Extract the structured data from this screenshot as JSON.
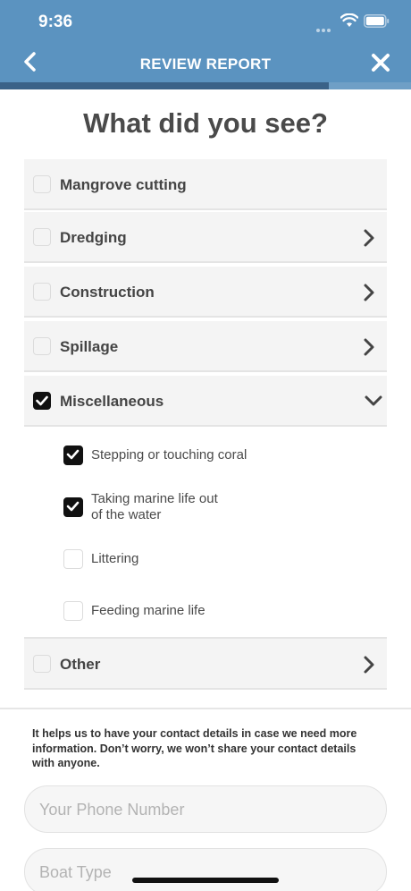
{
  "status_bar": {
    "time": "9:36"
  },
  "nav": {
    "title": "REVIEW REPORT"
  },
  "progress": {
    "fraction": 0.8
  },
  "page": {
    "title": "What did you see?"
  },
  "categories": [
    {
      "label": "Mangrove cutting",
      "checked": false,
      "chevron": "none"
    },
    {
      "label": "Dredging",
      "checked": false,
      "chevron": "right"
    },
    {
      "label": "Construction",
      "checked": false,
      "chevron": "right"
    },
    {
      "label": "Spillage",
      "checked": false,
      "chevron": "right"
    },
    {
      "label": "Miscellaneous",
      "checked": true,
      "chevron": "down"
    }
  ],
  "misc_items": [
    {
      "label": "Stepping or touching coral",
      "checked": true
    },
    {
      "label": "Taking marine life out\nof the water",
      "checked": true
    },
    {
      "label": "Littering",
      "checked": false
    },
    {
      "label": "Feeding marine life",
      "checked": false
    }
  ],
  "other": {
    "label": "Other",
    "checked": false,
    "chevron": "right"
  },
  "contact": {
    "help_text": "It helps us to have your contact details in case we need more information. Don’t worry, we won’t share your contact details with anyone.",
    "phone_placeholder": "Your Phone Number",
    "boat_placeholder": "Boat Type"
  },
  "colors": {
    "header": "#5b93c0",
    "progress_fill": "#3a6288",
    "checkbox_checked": "#111111"
  },
  "icons": {
    "back": "chevron-left-icon",
    "close": "close-icon",
    "expand": "chevron-right-icon",
    "collapse": "chevron-down-icon",
    "check": "checkmark-icon"
  }
}
